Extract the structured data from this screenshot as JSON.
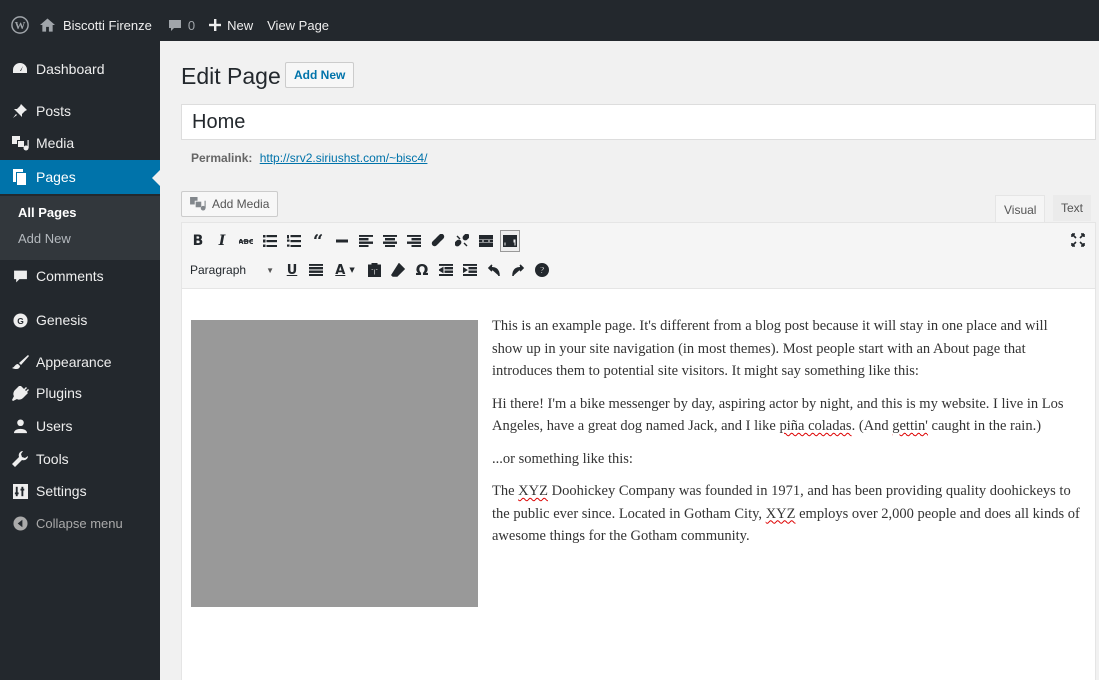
{
  "adminbar": {
    "wp_logo": "wordpress-logo-icon",
    "site_name": "Biscotti Firenze",
    "comments_count": "0",
    "new_label": "New",
    "view_page_label": "View Page"
  },
  "sidebar": {
    "items": [
      {
        "label": "Dashboard",
        "icon": "dashboard-icon"
      },
      {
        "label": "Posts",
        "icon": "pin-icon"
      },
      {
        "label": "Media",
        "icon": "media-icon"
      },
      {
        "label": "Pages",
        "icon": "page-icon"
      },
      {
        "label": "Comments",
        "icon": "comment-icon"
      },
      {
        "label": "Genesis",
        "icon": "genesis-icon"
      },
      {
        "label": "Appearance",
        "icon": "brush-icon"
      },
      {
        "label": "Plugins",
        "icon": "plug-icon"
      },
      {
        "label": "Users",
        "icon": "users-icon"
      },
      {
        "label": "Tools",
        "icon": "wrench-icon"
      },
      {
        "label": "Settings",
        "icon": "settings-icon"
      }
    ],
    "submenu": [
      "All Pages",
      "Add New"
    ],
    "collapse_label": "Collapse menu"
  },
  "header": {
    "title": "Edit Page",
    "add_new_label": "Add New"
  },
  "post": {
    "title": "Home",
    "permalink_label": "Permalink:",
    "permalink_url": "http://srv2.siriushst.com/~bisc4/"
  },
  "editor": {
    "add_media_label": "Add Media",
    "tab_visual": "Visual",
    "tab_text": "Text",
    "format_select": "Paragraph",
    "paragraphs": [
      "This is an example page. It's different from a blog post because it will stay in one place and will show up in your site navigation (in most themes). Most people start with an About page that introduces them to potential site visitors. It might say something like this:",
      "...or something like this:"
    ],
    "quote1": {
      "a": "Hi there! I'm a bike messenger by day, aspiring actor by night, and this is my website. I live in Los Angeles, have a great dog named Jack, and I like ",
      "w1": "piña coladas",
      "b": ". (And ",
      "w2": "gettin'",
      "c": " caught in the rain.)"
    },
    "quote2": {
      "a": "The ",
      "w1": "XYZ",
      "b": " Doohickey Company was founded in 1971, and has been providing quality doohickeys to the public ever since. Located in Gotham City, ",
      "w2": "XYZ",
      "c": " employs over 2,000 people and does all kinds of awesome things for the Gotham community."
    }
  },
  "colors": {
    "adminbar_bg": "#23282d",
    "accent": "#0073aa",
    "submenu_bg": "#32373c",
    "image_placeholder": "#999999"
  }
}
